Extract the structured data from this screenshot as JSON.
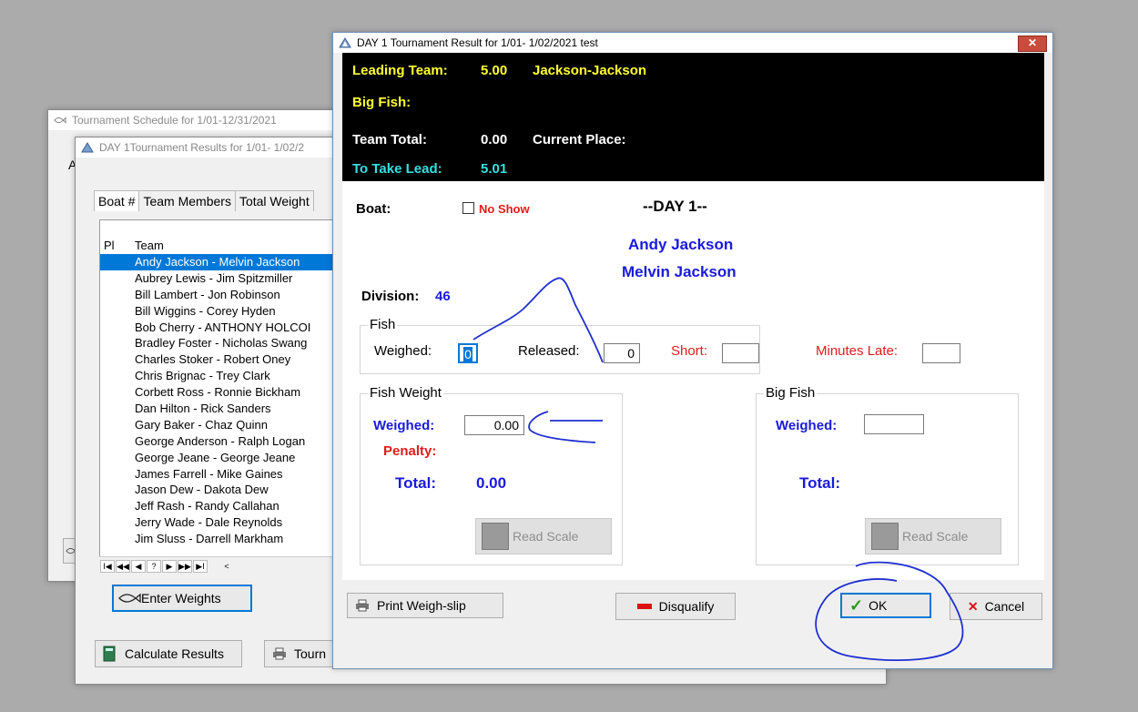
{
  "sched_window": {
    "title": "Tournament Schedule for  1/01-12/31/2021",
    "partial_label": "A"
  },
  "day_window": {
    "title": "DAY 1Tournament Results for  1/01- 1/02/2",
    "tabs": [
      "Boat #",
      "Team Members",
      "Total Weight"
    ],
    "columns": {
      "place": "Pl",
      "team": "Team"
    },
    "teams": [
      "Andy Jackson - Melvin Jackson",
      "Aubrey Lewis - Jim Spitzmiller",
      "Bill Lambert - Jon Robinson",
      "Bill Wiggins - Corey Hyden",
      "Bob Cherry - ANTHONY HOLCOI",
      "Bradley Foster - Nicholas Swang",
      "Charles Stoker - Robert Oney",
      "Chris Brignac - Trey Clark",
      "Corbett Ross - Ronnie Bickham",
      "Dan Hilton - Rick Sanders",
      "Gary Baker - Chaz Quinn",
      "George Anderson - Ralph Logan",
      "George Jeane - George Jeane",
      "James Farrell - Mike Gaines",
      "Jason Dew - Dakota Dew",
      "Jeff Rash - Randy Callahan",
      "Jerry Wade - Dale Reynolds",
      "Jim Sluss - Darrell Markham"
    ],
    "nav": [
      "I◀",
      "◀◀",
      "◀",
      "?",
      "▶",
      "▶▶",
      "▶I",
      "<"
    ],
    "enter_weights": "Enter Weights",
    "calculate_results": "Calculate Results",
    "tournament_btn": "Tourn"
  },
  "dialog": {
    "title": "DAY 1 Tournament Result for  1/01- 1/02/2021 test",
    "close": "✕",
    "leading_team_label": "Leading Team:",
    "leading_team_value": "5.00",
    "leading_team_name": "Jackson-Jackson",
    "big_fish_label": "Big Fish:",
    "team_total_label": "Team Total:",
    "team_total_value": "0.00",
    "current_place_label": "Current Place:",
    "to_take_lead_label": "To Take Lead:",
    "to_take_lead_value": "5.01",
    "boat_label": "Boat:",
    "no_show_label": "No Show",
    "day_heading": "--DAY 1--",
    "member1": "Andy Jackson",
    "member2": "Melvin Jackson",
    "division_label": "Division:",
    "division_value": "46",
    "fish_group": "Fish",
    "weighed_label": "Weighed:",
    "weighed_value": "0",
    "released_label": "Released:",
    "released_value": "0",
    "short_label": "Short:",
    "short_value": "",
    "minutes_late_label": "Minutes Late:",
    "minutes_late_value": "",
    "fish_weight_group": "Fish Weight",
    "fw_weighed_label": "Weighed:",
    "fw_weighed_value": "0.00",
    "penalty_label": "Penalty:",
    "fw_total_label": "Total:",
    "fw_total_value": "0.00",
    "read_scale": "Read Scale",
    "big_fish_group": "Big Fish",
    "bf_weighed_label": "Weighed:",
    "bf_weighed_value": "",
    "bf_total_label": "Total:",
    "print_weigh_slip": "Print Weigh-slip",
    "disqualify": "Disqualify",
    "ok": "OK",
    "cancel": "Cancel"
  },
  "colors": {
    "accent_blue": "#1a1adb",
    "red": "#e21b1b",
    "yellow": "#ffff33",
    "cyan": "#33e0e0",
    "selection": "#0078d7",
    "ink": "#1f2fd1"
  }
}
